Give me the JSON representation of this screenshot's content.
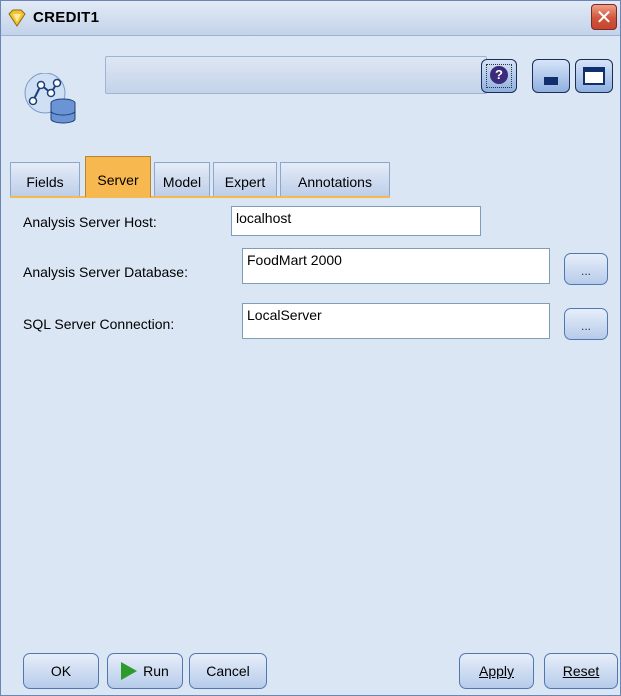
{
  "window": {
    "title": "CREDIT1"
  },
  "header": {
    "help_symbol": "?"
  },
  "tabs": [
    {
      "label": "Fields"
    },
    {
      "label": "Server"
    },
    {
      "label": "Model"
    },
    {
      "label": "Expert"
    },
    {
      "label": "Annotations"
    }
  ],
  "active_tab": "Server",
  "server": {
    "host_label": "Analysis Server Host:",
    "host_value": "localhost",
    "database_label": "Analysis Server Database:",
    "database_value": "FoodMart 2000",
    "database_browse": "...",
    "sql_label": "SQL Server Connection:",
    "sql_value": "LocalServer",
    "sql_browse": "..."
  },
  "footer": {
    "ok": "OK",
    "run": "Run",
    "cancel": "Cancel",
    "apply": "Apply",
    "reset": "Reset"
  },
  "colors": {
    "active_tab": "#f8b850",
    "window_bg": "#dbe6f5",
    "close_button": "#d0553c",
    "run_arrow": "#2c9b2c"
  }
}
